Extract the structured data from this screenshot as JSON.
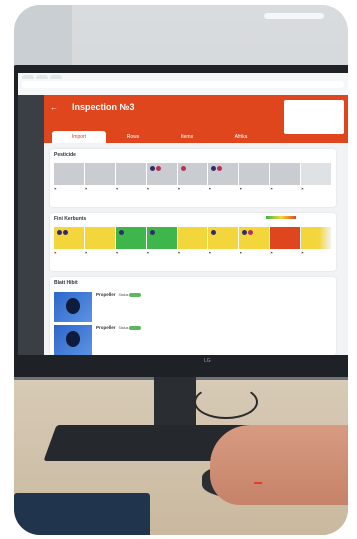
{
  "screen": {
    "app_title": "Inspection №3",
    "header_tabs": [
      "Import",
      "Rows",
      "Items",
      "Afrika"
    ],
    "sections": [
      {
        "title": "Pesticide"
      },
      {
        "title": "Fini Kerbunts"
      },
      {
        "title": "Blatt Hibit"
      }
    ],
    "items": [
      {
        "name": "Propeller",
        "status_label": "Status"
      },
      {
        "name": "Propeller",
        "status_label": "Status"
      }
    ],
    "monitor_brand": "LG"
  },
  "colors": {
    "header": "#e0461e",
    "ok": "#3fb64b",
    "warn": "#f3d63b",
    "bad": "#e0461e"
  }
}
